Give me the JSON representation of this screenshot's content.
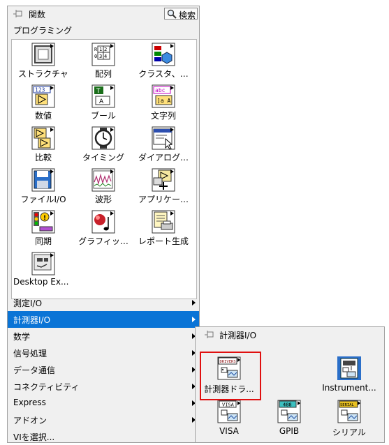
{
  "palette": {
    "title": "関数",
    "search_label": "検索",
    "programming_label": "プログラミング",
    "items": [
      {
        "label": "ストラクチャ",
        "icon": "structures-icon"
      },
      {
        "label": "配列",
        "icon": "array-icon"
      },
      {
        "label": "クラスタ、…",
        "icon": "cluster-icon"
      },
      {
        "label": "数値",
        "icon": "numeric-icon"
      },
      {
        "label": "ブール",
        "icon": "boolean-icon"
      },
      {
        "label": "文字列",
        "icon": "string-icon"
      },
      {
        "label": "比較",
        "icon": "comparison-icon"
      },
      {
        "label": "タイミング",
        "icon": "timing-icon"
      },
      {
        "label": "ダイアログ…",
        "icon": "dialog-icon"
      },
      {
        "label": "ファイルI/O",
        "icon": "file-io-icon"
      },
      {
        "label": "波形",
        "icon": "waveform-icon"
      },
      {
        "label": "アプリケー…",
        "icon": "application-control-icon"
      },
      {
        "label": "同期",
        "icon": "synchronization-icon"
      },
      {
        "label": "グラフィッ…",
        "icon": "graphics-sound-icon"
      },
      {
        "label": "レポート生成",
        "icon": "report-generation-icon"
      },
      {
        "label": "Desktop Ex...",
        "icon": "desktop-execution-icon"
      }
    ],
    "categories": [
      {
        "label": "測定I/O",
        "highlighted": false
      },
      {
        "label": "計測器I/O",
        "highlighted": true
      },
      {
        "label": "数学",
        "highlighted": false
      },
      {
        "label": "信号処理",
        "highlighted": false
      },
      {
        "label": "データ通信",
        "highlighted": false
      },
      {
        "label": "コネクティビティ",
        "highlighted": false
      },
      {
        "label": "Express",
        "highlighted": false
      },
      {
        "label": "アドオン",
        "highlighted": false
      },
      {
        "label": "VIを選択...",
        "highlighted": false
      }
    ],
    "highlight_color": "#0a74d6"
  },
  "subpalette": {
    "title": "計測器I/O",
    "items": [
      {
        "label": "計測器ドラ...",
        "icon": "instrument-drivers-icon",
        "badge": "DRIVERS"
      },
      {
        "label": "Instrument...",
        "icon": "instrument-assistant-icon",
        "badge": ""
      },
      {
        "label": "VISA",
        "icon": "visa-icon",
        "badge": "VISA"
      },
      {
        "label": "GPIB",
        "icon": "gpib-icon",
        "badge": "488"
      },
      {
        "label": "シリアル",
        "icon": "serial-icon",
        "badge": "SERIAL"
      }
    ],
    "selection_color": "#e01010"
  }
}
